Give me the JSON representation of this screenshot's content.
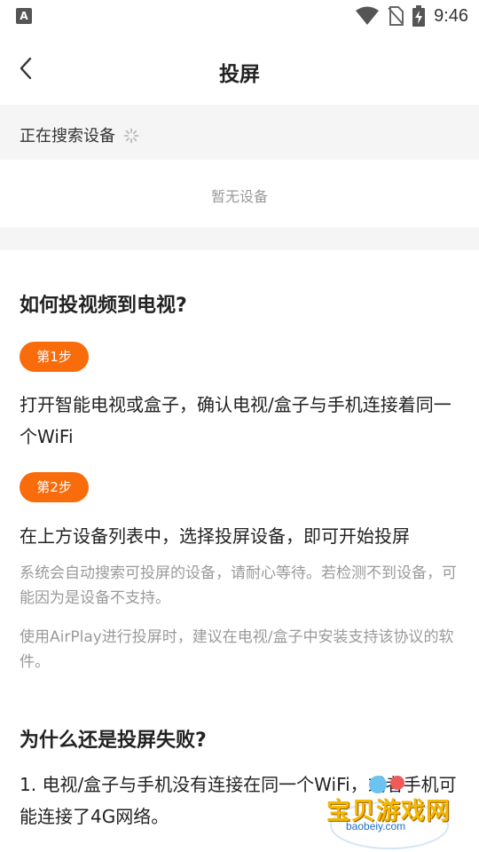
{
  "status_bar": {
    "left_icon": "A",
    "time": "9:46",
    "icons": [
      "wifi-icon",
      "no-sim-icon",
      "battery-charging-icon"
    ]
  },
  "header": {
    "title": "投屏",
    "back_icon": "chevron-left-icon"
  },
  "device_search": {
    "status_text": "正在搜索设备",
    "spinner_icon": "loading-spinner-icon",
    "empty_text": "暂无设备"
  },
  "guide": {
    "heading": "如何投视频到电视?",
    "steps": [
      {
        "badge": "第1步",
        "text": "打开智能电视或盒子，确认电视/盒子与手机连接着同一个WiFi"
      },
      {
        "badge": "第2步",
        "text": "在上方设备列表中，选择投屏设备，即可开始投屏"
      }
    ],
    "notes": [
      "系统会自动搜索可投屏的设备，请耐心等待。若检测不到设备，可能因为是设备不支持。",
      "使用AirPlay进行投屏时，建议在电视/盒子中安装支持该协议的软件。"
    ]
  },
  "faq": {
    "heading": "为什么还是投屏失败?",
    "items": [
      "1. 电视/盒子与手机没有连接在同一个WiFi，或者手机可能连接了4G网络。"
    ]
  },
  "watermark": {
    "title": "宝贝游戏网",
    "url": "baobeiy.com"
  },
  "colors": {
    "accent": "#f86c0c",
    "muted_text": "#9a9a9a",
    "band_bg": "#f5f5f5"
  }
}
